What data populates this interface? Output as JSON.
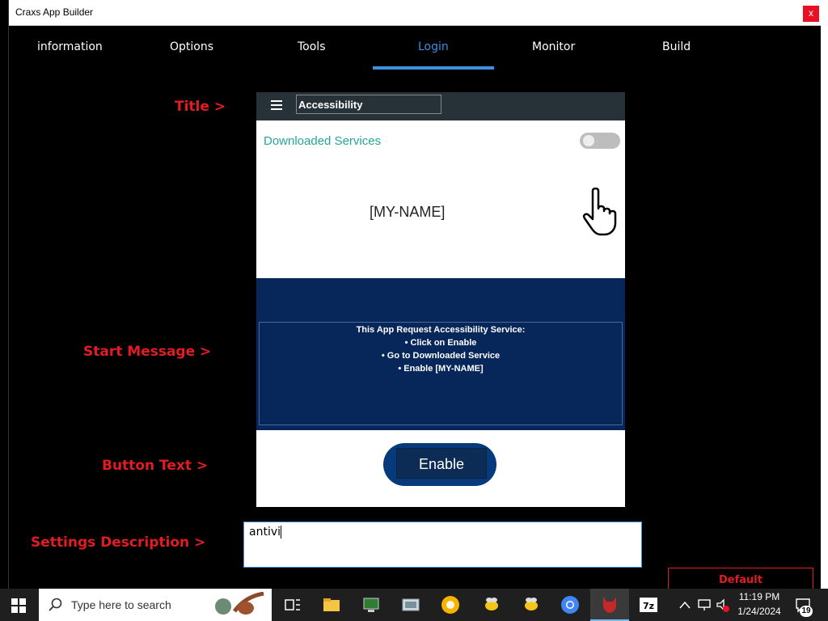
{
  "window": {
    "title": "Craxs App Builder",
    "close_label": "x"
  },
  "tabs": [
    {
      "label": "information",
      "active": false
    },
    {
      "label": "Options",
      "active": false
    },
    {
      "label": "Tools",
      "active": false
    },
    {
      "label": "Login",
      "active": true
    },
    {
      "label": "Monitor",
      "active": false
    },
    {
      "label": "Build",
      "active": false
    }
  ],
  "labels": {
    "title": "Title >",
    "start_message": "Start Message >",
    "button_text": "Button Text >",
    "settings_description": "Settings Description >"
  },
  "preview": {
    "title_value": "Accessibility",
    "downloaded_services": "Downloaded Services",
    "my_name": "[MY-NAME]",
    "message_lines": [
      "This App Request Accessibility Service:",
      "• Click on Enable",
      "• Go to Downloaded Service",
      "• Enable [MY-NAME]"
    ],
    "button_label": "Enable"
  },
  "settings_description_value": "antivi",
  "default_button": "Default",
  "taskbar": {
    "search_placeholder": "Type here to search",
    "time": "11:19 PM",
    "date": "1/24/2024",
    "notification_count": "19"
  },
  "colors": {
    "accent": "#3d8fe0",
    "label_red": "#e21c22",
    "message_bg": "#07275a",
    "toolbar_bg": "#263238",
    "teal_text": "#26a69a"
  }
}
